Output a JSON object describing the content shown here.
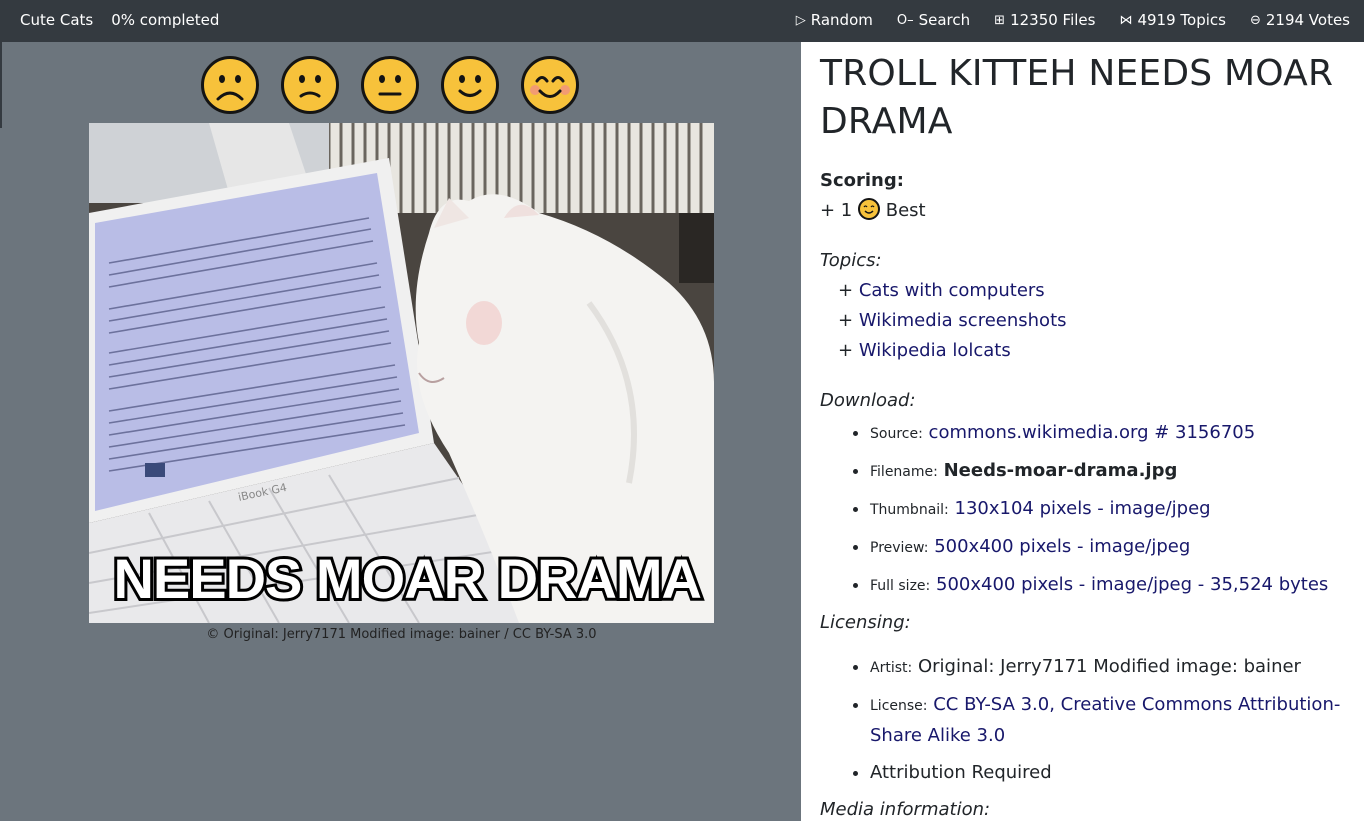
{
  "topbar": {
    "brand": "Cute Cats",
    "progress": "0% completed",
    "nav": [
      {
        "icon": "play-icon",
        "label": "Random"
      },
      {
        "icon": "key-icon",
        "label": "Search"
      },
      {
        "icon": "grid-icon",
        "label": "12350 Files"
      },
      {
        "icon": "bowtie-icon",
        "label": "4919 Topics"
      },
      {
        "icon": "vote-icon",
        "label": "2194 Votes"
      }
    ]
  },
  "rating": {
    "faces": [
      "very-sad-face-icon",
      "sad-face-icon",
      "neutral-face-icon",
      "slight-smile-face-icon",
      "happy-face-icon"
    ]
  },
  "image": {
    "caption_text": "NEEDS MOAR DRAMA",
    "credit": "© Original: Jerry7171 Modified image: bainer / CC BY-SA 3.0",
    "laptop_label": "iBook G4"
  },
  "details": {
    "title": "TROLL KITTEH NEEDS MOAR DRAMA",
    "scoring_label": "Scoring:",
    "score_prefix": "+ 1",
    "score_text": "Best",
    "topics_label": "Topics:",
    "topics": [
      "Cats with computers",
      "Wikimedia screenshots",
      "Wikipedia lolcats"
    ],
    "download_label": "Download:",
    "download": {
      "source_label": "Source:",
      "source_value": "commons.wikimedia.org # 3156705",
      "filename_label": "Filename:",
      "filename_value": "Needs-moar-drama.jpg",
      "thumbnail_label": "Thumbnail:",
      "thumbnail_value": "130x104 pixels - image/jpeg",
      "preview_label": "Preview:",
      "preview_value": "500x400 pixels - image/jpeg",
      "fullsize_label": "Full size:",
      "fullsize_value": "500x400 pixels - image/jpeg - 35,524 bytes"
    },
    "licensing_label": "Licensing:",
    "licensing": {
      "artist_label": "Artist:",
      "artist_value": "Original: Jerry7171 Modified image: bainer",
      "license_label": "License:",
      "license_value": "CC BY-SA 3.0, Creative Commons Attribution-Share Alike 3.0",
      "attribution": "Attribution Required"
    },
    "media_label": "Media information:"
  }
}
